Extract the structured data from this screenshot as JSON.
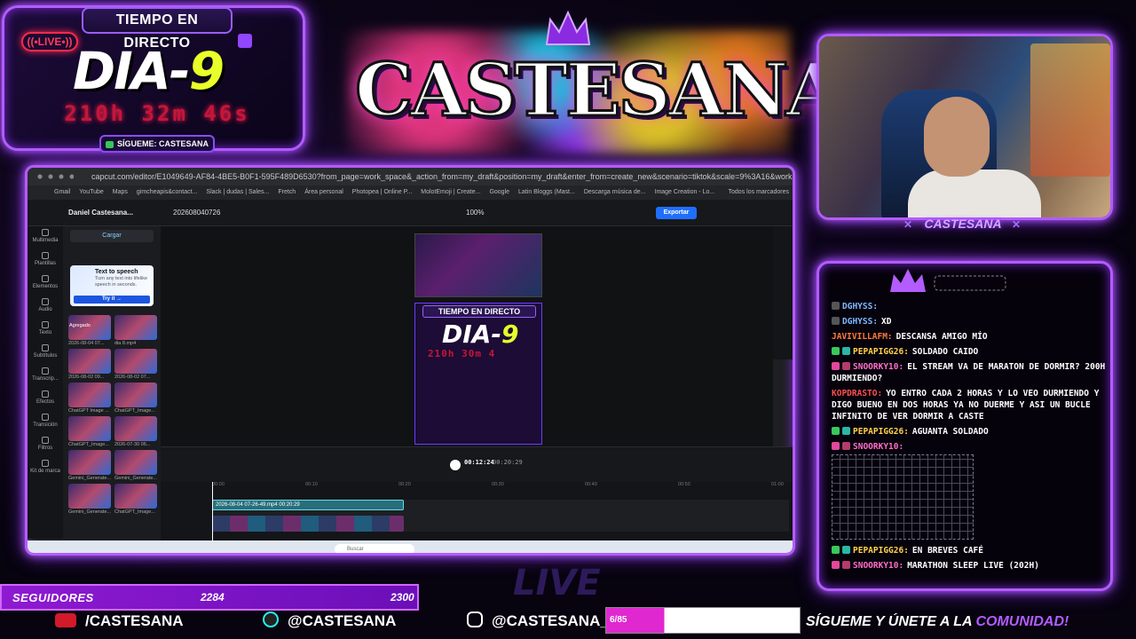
{
  "overlay": {
    "timer": {
      "header": "TIEMPO EN DIRECTO",
      "live_badge": "((•LIVE•))",
      "day_word": "DIA-",
      "day_number": "9",
      "countdown": "210h 32m 46s",
      "follow_text": "SÍGUEME: CASTESANA"
    },
    "logo_text": "CASTESANA",
    "cam_label": "CASTESANA",
    "big_live": "LIVE"
  },
  "chat": {
    "messages": [
      {
        "user": "DGHYSS:",
        "text": "",
        "color": "#7fb8ff",
        "badges": [
          "gray"
        ]
      },
      {
        "user": "DGHYSS:",
        "text": "XD",
        "color": "#7fb8ff",
        "badges": [
          "gray"
        ]
      },
      {
        "user": "JAVIVILLAFM:",
        "text": "DESCANSA AMIGO MÍO",
        "color": "#ff7b3a",
        "badges": []
      },
      {
        "user": "PEPAPIGG26:",
        "text": "SOLDADO CAIDO",
        "color": "#ffd24a",
        "badges": [
          "mod",
          "sub"
        ]
      },
      {
        "user": "SNOORKY10:",
        "text": "EL STREAM VA DE MARATON DE DORMIR? 200H DURMIENDO?",
        "color": "#ff6ec7",
        "badges": [
          "vip",
          "x"
        ]
      },
      {
        "user": "KOPDRASTO:",
        "text": "YO ENTRO CADA 2 HORAS Y LO VEO DURMIENDO Y DIGO BUENO EN DOS HORAS YA NO DUERME Y ASI UN BUCLE INFINITO DE VER DORMIR A CASTE",
        "color": "#ff4f4f",
        "badges": []
      },
      {
        "user": "PEPAPIGG26:",
        "text": "AGUANTA SOLDADO",
        "color": "#ffd24a",
        "badges": [
          "mod",
          "sub"
        ]
      },
      {
        "user": "SNOORKY10:",
        "text": "",
        "color": "#ff6ec7",
        "badges": [
          "vip",
          "x"
        ],
        "ascii": true
      },
      {
        "user": "PEPAPIGG26:",
        "text": "EN BREVES CAFÉ",
        "color": "#ffd24a",
        "badges": [
          "mod",
          "sub"
        ]
      },
      {
        "user": "SNOORKY10:",
        "text": "MARATHON SLEEP LIVE (202H)",
        "color": "#ff6ec7",
        "badges": [
          "vip",
          "x"
        ]
      }
    ]
  },
  "browser": {
    "url": "capcut.com/editor/E1049649-AF84-4BE5-B0F1-595F489D6530?from_page=work_space&_action_from=my_draft&position=my_draft&enter_from=create_new&scenario=tiktok&scale=9%3A16&workspaceId=7323504956072493056",
    "bookmarks": [
      "Gmail",
      "YouTube",
      "Maps",
      "gimcheapis&contact...",
      "Slack | dudas | Sales...",
      "Fretch",
      "Área personal",
      "Photopea | Online P...",
      "MolotEmoji | Create...",
      "Google",
      "Latin Bloggs (Mast...",
      "Descarga música de...",
      "Image Creation - Lo..."
    ],
    "bookmarks_end": "Todos los marcadores",
    "project": "Daniel Castesana...",
    "draft": "20260804072​6",
    "zoom": "100%",
    "export_label": "Exportar",
    "upload_label": "Cargar",
    "tts_title": "Text to speech",
    "tts_sub": "Turn any text into lifelike speech in seconds.",
    "tts_btn": "Try it →",
    "side_nav": [
      "Multimedia",
      "Plantillas",
      "Elementos",
      "Audio",
      "Texto",
      "Subtítulos",
      "Transcrip...",
      "Efectos",
      "Transición",
      "Filtros",
      "Kit de marca"
    ],
    "thumbs": [
      {
        "label": "Agregado",
        "sub": "2026-08-04 07..."
      },
      {
        "label": "",
        "sub": "dia 8.mp4"
      },
      {
        "label": "",
        "sub": "2026-08-02 09..."
      },
      {
        "label": "",
        "sub": "2026-08-02 07..."
      },
      {
        "label": "",
        "sub": "ChatGPT Image ..."
      },
      {
        "label": "",
        "sub": "ChatGPT_Image..."
      },
      {
        "label": "",
        "sub": "ChatGPT_Image..."
      },
      {
        "label": "",
        "sub": "2026-07-30 06..."
      },
      {
        "label": "",
        "sub": "Gemini_Generate..."
      },
      {
        "label": "",
        "sub": "Gemini_Generate..."
      },
      {
        "label": "",
        "sub": "Gemini_Generate..."
      },
      {
        "label": "",
        "sub": "ChatGPT_Image..."
      }
    ],
    "preview": {
      "title": "TIEMPO EN DIRECTO",
      "day_word": "DIA-",
      "day_number": "9",
      "count": "210h 30m 4"
    },
    "play_current": "00:12:24",
    "play_total": "00:20:29",
    "ruler": [
      "00:00",
      "00:10",
      "00:20",
      "00:30",
      "00:40",
      "00:50",
      "01:00"
    ],
    "track1_label": "2026-08-04 07-26-49.mp4  00:20:29",
    "search_label": "Buscar"
  },
  "bottom": {
    "followers_label": "SEGUIDORES",
    "followers_value": "2284",
    "followers_goal": "2300",
    "youtube": "/CASTESANA",
    "tiktok": "@CASTESANA",
    "instagram": "@CASTESANA_",
    "sub_value": "6/85",
    "community_prefix": "SÍGUEME Y ÚNETE A LA",
    "community_highlight": "COMUNIDAD!"
  },
  "colors": {
    "neon_purple": "#b35cff",
    "accent_yellow": "#e8ff2a",
    "countdown_red": "#c5163a",
    "export_blue": "#1f6fff"
  }
}
